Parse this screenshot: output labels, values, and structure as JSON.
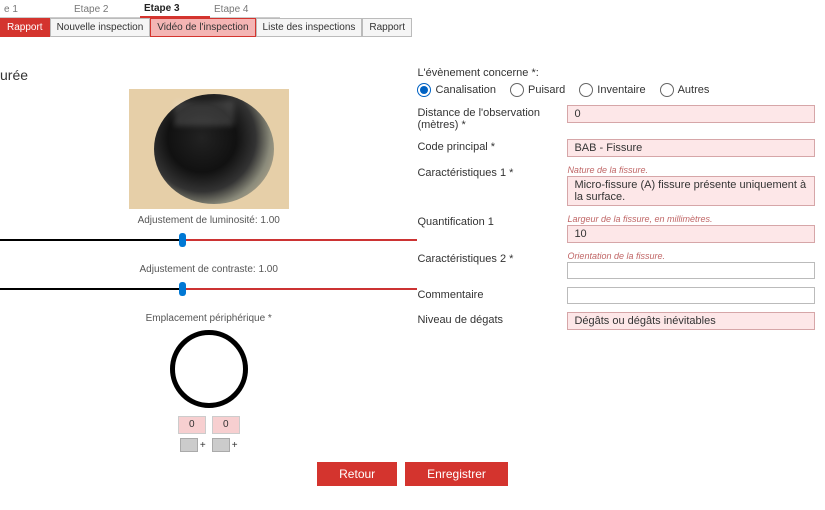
{
  "steps": {
    "s1": "e 1",
    "s2": "Etape 2",
    "s3": "Etape 3",
    "s4": "Etape 4",
    "activeIndex": 2
  },
  "tabs": {
    "t0": "Rapport",
    "t1": "Nouvelle inspection",
    "t2": "Vidéo de l'inspection",
    "t3": "Liste des inspections",
    "t4": "Rapport"
  },
  "left": {
    "sectionTitle": "urée",
    "lumLabel": "Adjustement de luminosité: 1.00",
    "contLabel": "Adjustement de contraste: 1.00",
    "periphLabel": "Emplacement périphérique *",
    "coordA": "0",
    "coordB": "0",
    "plus": "+"
  },
  "form": {
    "header": "L'évènement concerne *:",
    "radios": {
      "canalisation": "Canalisation",
      "puisard": "Puisard",
      "inventaire": "Inventaire",
      "autres": "Autres"
    },
    "distanceLabel": "Distance de l'observation (mètres) *",
    "distanceValue": "0",
    "codeLabel": "Code principal *",
    "codeValue": "BAB - Fissure",
    "carac1Label": "Caractéristiques 1 *",
    "carac1Hint": "Nature de la fissure.",
    "carac1Value": "Micro-fissure (A) fissure présente uniquement à la surface.",
    "quantLabel": "Quantification 1",
    "quantHint": "Largeur de la fissure, en millimètres.",
    "quantValue": "10",
    "carac2Label": "Caractéristiques 2 *",
    "carac2Hint": "Orientation de la fissure.",
    "carac2Value": "",
    "commentLabel": "Commentaire",
    "commentValue": "",
    "niveauLabel": "Niveau de dégats",
    "niveauValue": "Dégâts ou dégâts inévitables"
  },
  "footer": {
    "back": "Retour",
    "save": "Enregistrer"
  }
}
